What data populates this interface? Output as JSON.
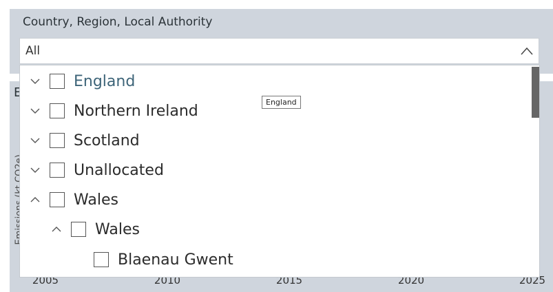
{
  "slicer": {
    "title": "Country, Region, Local Authority",
    "selected_value": "All"
  },
  "chart_peek": {
    "title_fragment": "E",
    "ylabel_fragment": "Emissions (kt CO2e)",
    "x_ticks": [
      "2005",
      "2010",
      "2015",
      "2020",
      "2025"
    ]
  },
  "list": {
    "items": [
      {
        "label": "England",
        "expanded": false,
        "checked": false,
        "level": 0,
        "hover": true
      },
      {
        "label": "Northern Ireland",
        "expanded": false,
        "checked": false,
        "level": 0
      },
      {
        "label": "Scotland",
        "expanded": false,
        "checked": false,
        "level": 0
      },
      {
        "label": "Unallocated",
        "expanded": false,
        "checked": false,
        "level": 0
      },
      {
        "label": "Wales",
        "expanded": true,
        "checked": false,
        "level": 0
      },
      {
        "label": "Wales",
        "expanded": true,
        "checked": false,
        "level": 1
      },
      {
        "label": "Blaenau Gwent",
        "checked": false,
        "level": 2
      }
    ]
  },
  "tooltip": {
    "text": "England"
  }
}
